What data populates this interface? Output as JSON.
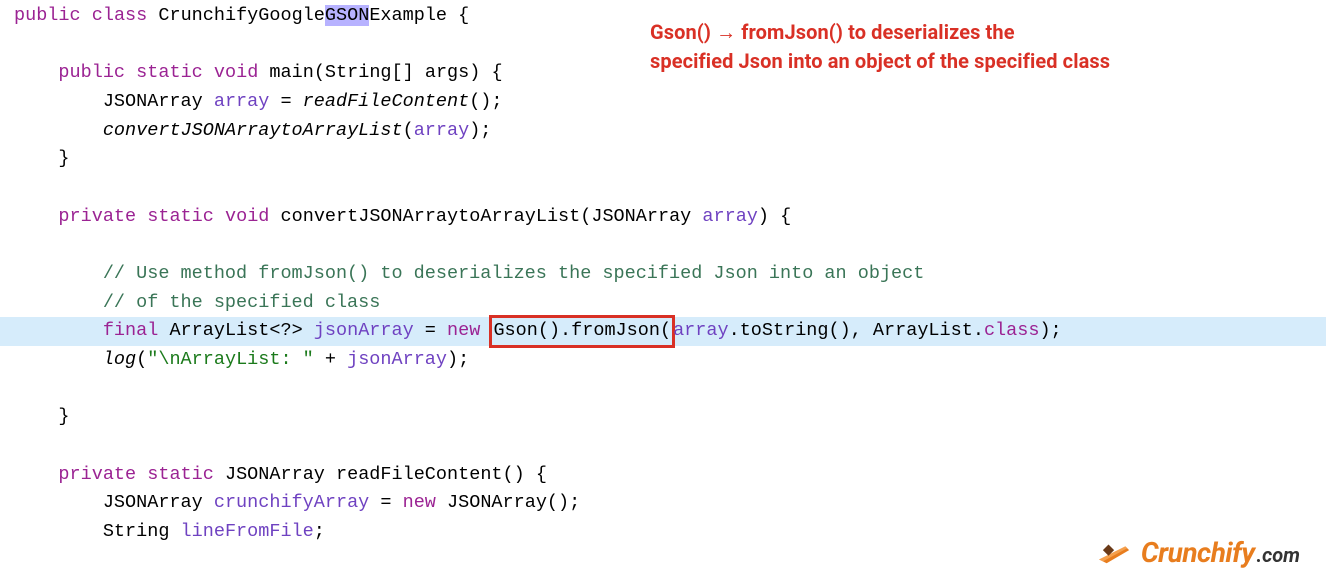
{
  "annotation": {
    "line1": "Gson() → fromJson() to deserializes the",
    "line2": "specified Json into an object of the specified class"
  },
  "code": {
    "l1_pre": "public class CrunchifyGoogle",
    "l1_sel": "GSON",
    "l1_post": "Example {",
    "l2": "",
    "l3_kw1": "public",
    "l3_kw2": "static",
    "l3_kw3": "void",
    "l3_sig": " main(String[] args) {",
    "l4_type": "        JSONArray ",
    "l4_var": "array",
    "l4_assign": " = ",
    "l4_call": "readFileContent",
    "l4_tail": "();",
    "l5_call": "convertJSONArraytoArrayList",
    "l5_arg": "array",
    "l6": "    }",
    "l7": "",
    "l8_kw1": "private",
    "l8_kw2": "static",
    "l8_kw3": "void",
    "l8_name": " convertJSONArraytoArrayList(JSONArray ",
    "l8_param": "array",
    "l8_tail": ") {",
    "l9": "",
    "l10": "        // Use method fromJson() to deserializes the specified Json into an object",
    "l11": "        // of the specified class",
    "l12_kw": "final",
    "l12_type": " ArrayList<?> ",
    "l12_var": "jsonArray",
    "l12_assign": " = ",
    "l12_new": "new",
    "l12_boxed": "Gson().fromJson(",
    "l12_arg": "array",
    "l12_after": ".toString(), ArrayList.",
    "l12_class": "class",
    "l12_tail": ");",
    "l13_call": "log",
    "l13_str": "\"\\nArrayList: \"",
    "l13_plus": " + ",
    "l13_var": "jsonArray",
    "l13_tail": ");",
    "l14": "",
    "l15": "    }",
    "l16": "",
    "l17_kw1": "private",
    "l17_kw2": "static",
    "l17_type": " JSONArray readFileContent() {",
    "l18_type": "        JSONArray ",
    "l18_var": "crunchifyArray",
    "l18_assign": " = ",
    "l18_new": "new",
    "l18_tail": " JSONArray();",
    "l19_type": "        String ",
    "l19_var": "lineFromFile",
    "l19_tail": ";"
  },
  "logo": {
    "name": "Crunchify",
    "tld": ".com"
  }
}
